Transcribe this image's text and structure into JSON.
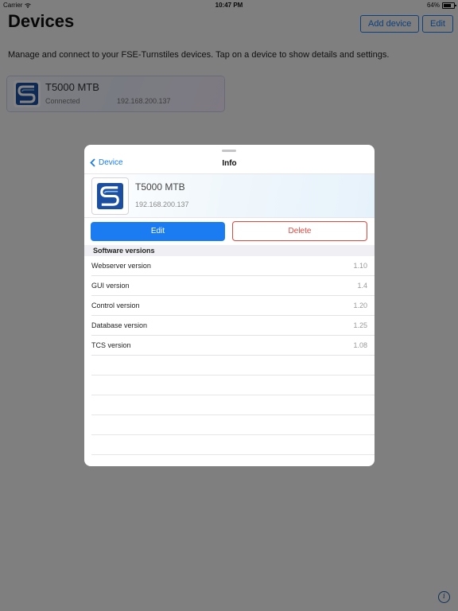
{
  "status_bar": {
    "carrier": "Carrier",
    "time": "10:47 PM",
    "battery": "64%"
  },
  "header": {
    "title": "Devices",
    "add_label": "Add device",
    "edit_label": "Edit"
  },
  "intro": "Manage and connect to your FSE-Turnstiles devices. Tap on a device to show details and settings.",
  "device_card": {
    "name": "T5000 MTB",
    "status": "Connected",
    "ip": "192.168.200.137"
  },
  "modal": {
    "back_label": "Device",
    "title": "Info",
    "device_name": "T5000 MTB",
    "device_ip": "192.168.200.137",
    "edit_label": "Edit",
    "delete_label": "Delete",
    "section_title": "Software versions",
    "versions": [
      {
        "label": "Webserver version",
        "value": "1.10"
      },
      {
        "label": "GUI version",
        "value": "1.4"
      },
      {
        "label": "Control version",
        "value": "1.20"
      },
      {
        "label": "Database version",
        "value": "1.25"
      },
      {
        "label": "TCS version",
        "value": "1.08"
      }
    ]
  },
  "colors": {
    "accent": "#1a7cf0",
    "danger": "#e0483e",
    "logo_blue": "#1c4fa0"
  },
  "icons": [
    "wifi-icon",
    "battery-icon",
    "chevron-left-icon",
    "fse-logo-icon",
    "info-icon"
  ]
}
